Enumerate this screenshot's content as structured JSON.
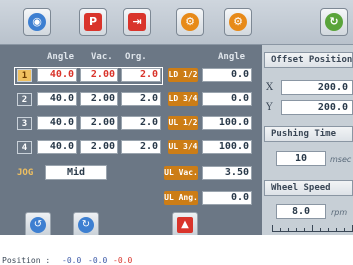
{
  "header": {
    "col_angle": "Angle",
    "col_vac": "Vac.",
    "col_org": "Org.",
    "col_angle2": "Angle"
  },
  "rows": [
    {
      "num": "1",
      "angle": "40.0",
      "vac": "2.00",
      "org": "2.0"
    },
    {
      "num": "2",
      "angle": "40.0",
      "vac": "2.00",
      "org": "2.0"
    },
    {
      "num": "3",
      "angle": "40.0",
      "vac": "2.00",
      "org": "2.0"
    },
    {
      "num": "4",
      "angle": "40.0",
      "vac": "2.00",
      "org": "2.0"
    }
  ],
  "params": [
    {
      "label": "LD 1/2",
      "value": "0.0"
    },
    {
      "label": "LD 3/4",
      "value": "0.0"
    },
    {
      "label": "UL 1/2",
      "value": "100.0"
    },
    {
      "label": "UL 3/4",
      "value": "100.0"
    },
    {
      "label": "UL Vac.",
      "value": "3.50"
    },
    {
      "label": "UL Ang.",
      "value": "0.0"
    }
  ],
  "jog": {
    "label": "JOG",
    "value": "Mid"
  },
  "offset": {
    "title": "Offset Position",
    "x_label": "X",
    "x_value": "200.0",
    "y_label": "Y",
    "y_value": "200.0"
  },
  "pushing": {
    "title": "Pushing Time",
    "value": "10",
    "unit": "msec"
  },
  "wheel": {
    "title": "Wheel Speed",
    "value": "8.0",
    "unit": "rpm"
  },
  "status": {
    "label": "Position :",
    "v1": "-0.0",
    "v2": "-0.0",
    "v3": "-0.0"
  },
  "toolbar": {
    "p_label": "P",
    "arrow_glyph": "↻"
  },
  "colors": {
    "panel": "#6b7785",
    "accent": "#cc7d16",
    "red_text": "#d9342b"
  }
}
